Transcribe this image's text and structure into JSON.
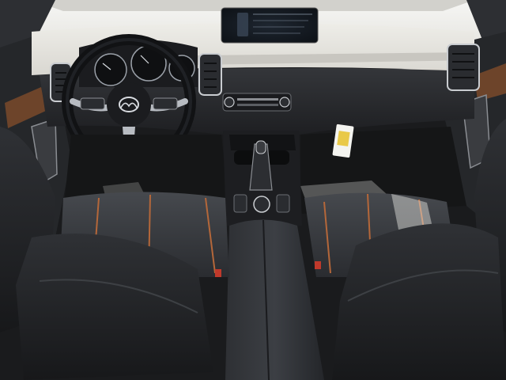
{
  "scene": {
    "subject": "vehicle-interior",
    "brand": "Mazda",
    "colors": {
      "dash_upper": "#ecebe6",
      "dash_lower": "#2b2d31",
      "seat_leather": "#3a3c40",
      "seat_stitch": "#b4673a",
      "floor_mat": "#151617",
      "console": "#2a2c30",
      "chrome": "#c9ccd0",
      "wood_trim": "#7a4a2a",
      "tag_yellow": "#e9c948"
    },
    "infotainment": {
      "lines": [
        "",
        "",
        ""
      ]
    },
    "hang_tag": {
      "text": ""
    }
  }
}
